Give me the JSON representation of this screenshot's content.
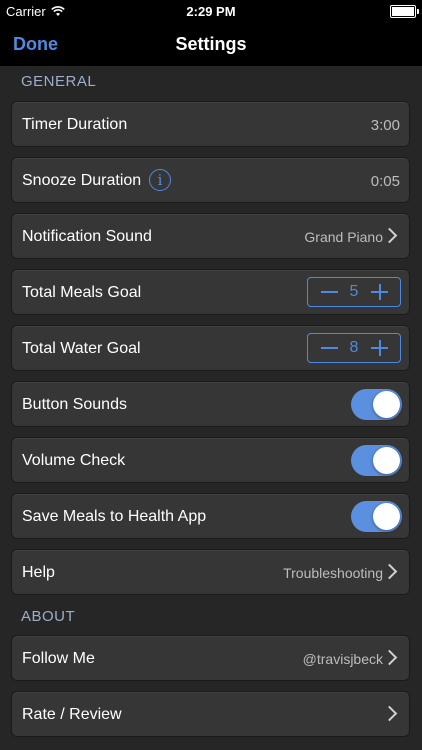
{
  "status_bar": {
    "carrier": "Carrier",
    "time": "2:29 PM"
  },
  "nav": {
    "done_label": "Done",
    "title": "Settings"
  },
  "colors": {
    "accent": "#4e8be0",
    "toggle_on": "#5b8fe0",
    "background": "#262626",
    "row": "#363636"
  },
  "general": {
    "header": "GENERAL",
    "timer_duration": {
      "label": "Timer Duration",
      "value": "3:00"
    },
    "snooze_duration": {
      "label": "Snooze Duration",
      "value": "0:05",
      "icon": "info-icon"
    },
    "notification_sound": {
      "label": "Notification Sound",
      "value": "Grand Piano"
    },
    "total_meals_goal": {
      "label": "Total Meals Goal",
      "value": "5"
    },
    "total_water_goal": {
      "label": "Total Water Goal",
      "value": "8"
    },
    "button_sounds": {
      "label": "Button Sounds",
      "on": true
    },
    "volume_check": {
      "label": "Volume Check",
      "on": true
    },
    "save_meals_health": {
      "label": "Save Meals to Health App",
      "on": true
    },
    "help": {
      "label": "Help",
      "value": "Troubleshooting"
    }
  },
  "about": {
    "header": "ABOUT",
    "follow_me": {
      "label": "Follow Me",
      "value": "@travisjbeck"
    },
    "rate_review": {
      "label": "Rate / Review"
    }
  }
}
